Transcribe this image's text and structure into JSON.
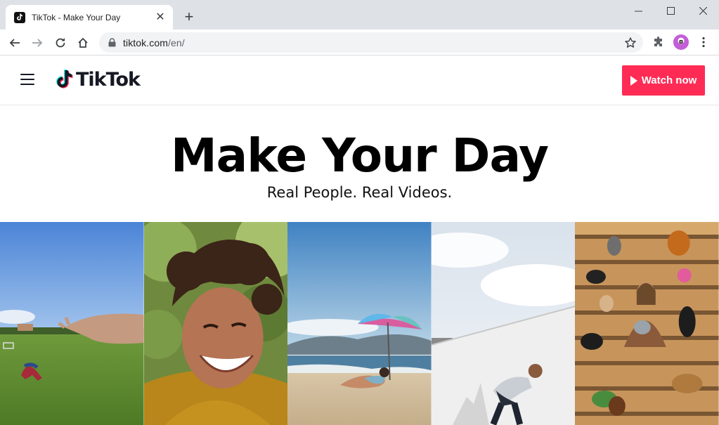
{
  "browser": {
    "tab_title": "TikTok - Make Your Day",
    "tab_close": "✕",
    "new_tab": "+",
    "url_host": "tiktok.com",
    "url_path": "/en/"
  },
  "header": {
    "logo_text": "TikTok",
    "watch_button": "Watch now",
    "accent_color": "#fe2c55"
  },
  "hero": {
    "title": "Make Your Day",
    "subtitle": "Real People. Real Videos."
  },
  "gallery": {
    "panels": [
      {
        "scene": "person-yoga-on-grass-field"
      },
      {
        "scene": "smiling-woman-closeup"
      },
      {
        "scene": "beach-with-umbrella"
      },
      {
        "scene": "man-on-white-wall"
      },
      {
        "scene": "woman-with-dogs-on-bleachers"
      }
    ]
  }
}
